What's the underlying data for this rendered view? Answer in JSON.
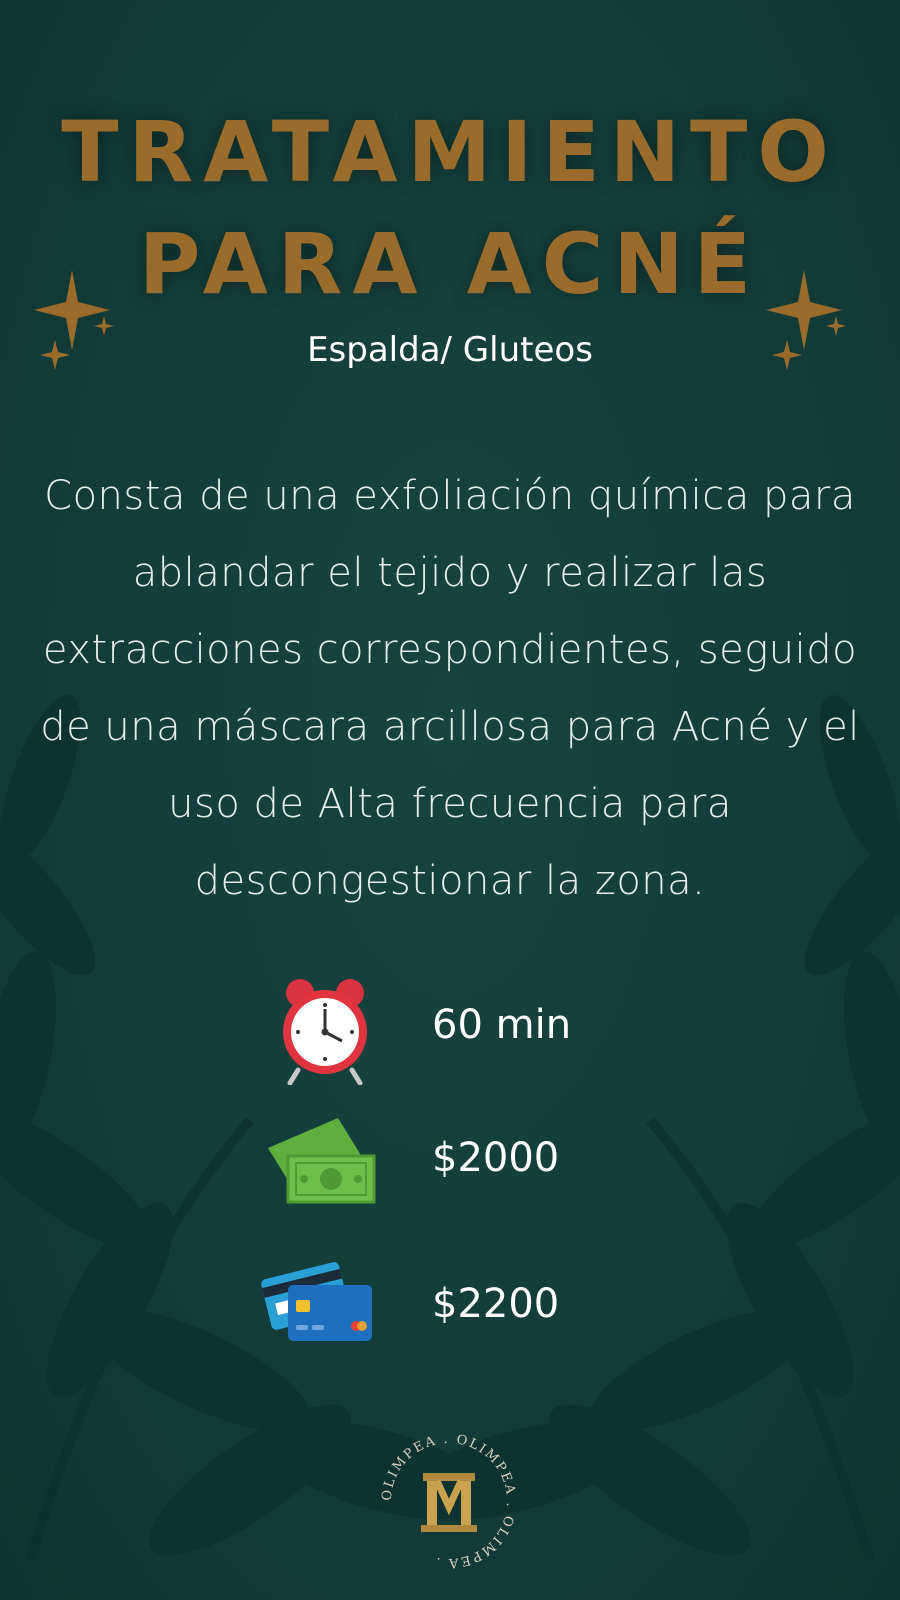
{
  "title": {
    "line1": "TRATAMIENTO",
    "line2": "PARA ACNÉ"
  },
  "subtitle": "Espalda/ Gluteos",
  "description": "Consta de una exfoliación química para ablandar el tejido y realizar las extracciones correspondientes, seguido de una máscara arcillosa para Acné y el uso de Alta frecuencia para descongestionar la zona.",
  "details": {
    "duration": {
      "icon": "alarm-clock-icon",
      "text": "60 min"
    },
    "cash_price": {
      "icon": "cash-icon",
      "text": "$2000"
    },
    "card_price": {
      "icon": "credit-cards-icon",
      "text": "$2200"
    }
  },
  "logo": {
    "letter": "M",
    "ring_text": "OLIMPEA . OLIMPEA . OLIMPEA ."
  },
  "colors": {
    "background": "#143f3c",
    "gold": "#9a6c2c",
    "text": "#ffffff"
  }
}
